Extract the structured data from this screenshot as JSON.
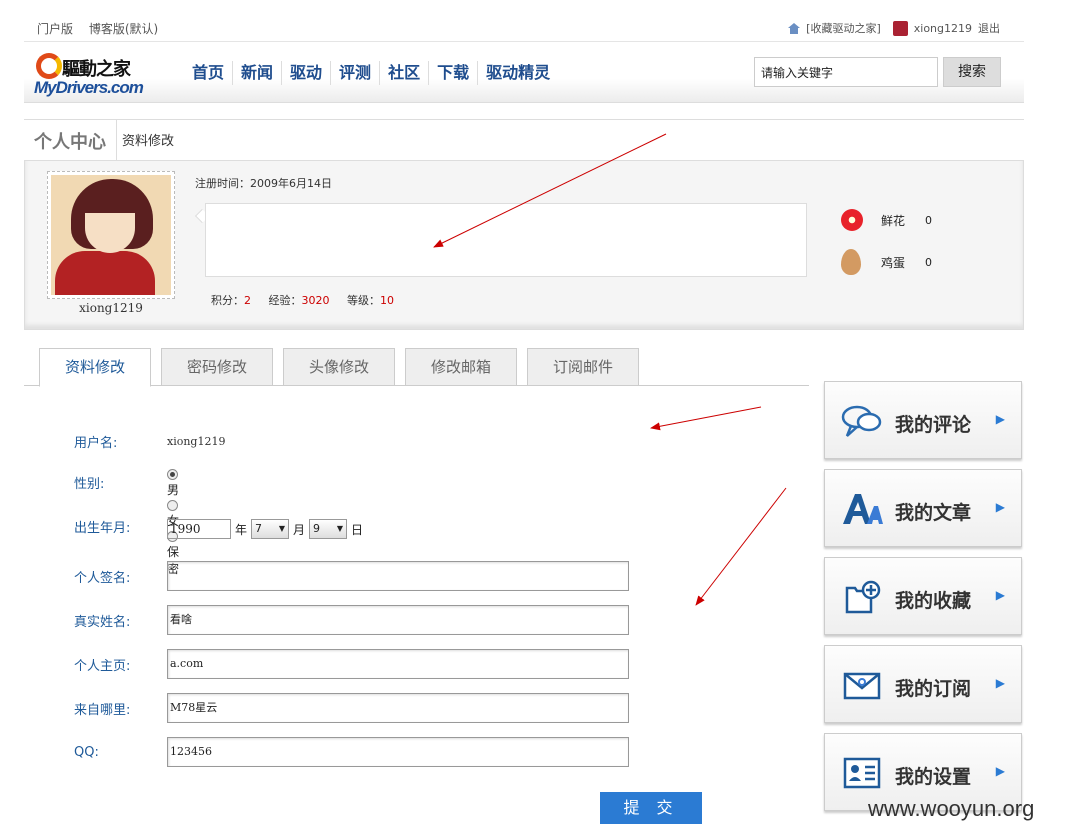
{
  "topbar": {
    "left_links": [
      "门户版",
      "博客版(默认)"
    ],
    "bookmark": "[收藏驱动之家]",
    "username": "xiong1219",
    "logout": "退出"
  },
  "header": {
    "logo_cn": "驅動之家",
    "logo_en": "MyDrivers.com",
    "nav": [
      "首页",
      "新闻",
      "驱动",
      "评测",
      "社区",
      "下载",
      "驱动精灵"
    ],
    "search_placeholder": "请输入关键字",
    "search_button": "搜索"
  },
  "breadcrumb": {
    "section": "个人中心",
    "page": "资料修改"
  },
  "profile": {
    "username": "xiong1219",
    "reg_time": "注册时间：2009年6月14日",
    "stats": [
      {
        "label": "积分：",
        "value": "2"
      },
      {
        "label": "经验：",
        "value": "3020"
      },
      {
        "label": "等级：",
        "value": "10"
      }
    ],
    "gifts": [
      {
        "name": "鲜花",
        "count": "0",
        "icon": "flower-icon"
      },
      {
        "name": "鸡蛋",
        "count": "0",
        "icon": "egg-icon"
      }
    ]
  },
  "tabs": [
    "资料修改",
    "密码修改",
    "头像修改",
    "修改邮箱",
    "订阅邮件"
  ],
  "form": {
    "username": {
      "label": "用户名:",
      "value": "xiong1219"
    },
    "gender": {
      "label": "性别:",
      "options": [
        "男",
        "女",
        "保密"
      ],
      "selected": "男"
    },
    "dob": {
      "label": "出生年月:",
      "year": "1990",
      "year_unit": "年",
      "month": "7",
      "month_unit": "月",
      "day": "9",
      "day_unit": "日"
    },
    "signature": {
      "label": "个人签名:",
      "value": ""
    },
    "realname": {
      "label": "真实姓名:",
      "value": "看啥"
    },
    "homepage": {
      "label": "个人主页:",
      "value": "a.com"
    },
    "from": {
      "label": "来自哪里:",
      "value": "M78星云"
    },
    "qq": {
      "label": "QQ:",
      "value": "123456"
    },
    "submit": "提 交"
  },
  "sidebar": [
    {
      "label": "我的评论",
      "icon": "comment-icon"
    },
    {
      "label": "我的文章",
      "icon": "article-icon"
    },
    {
      "label": "我的收藏",
      "icon": "favorite-icon"
    },
    {
      "label": "我的订阅",
      "icon": "subscribe-icon"
    },
    {
      "label": "我的设置",
      "icon": "settings-icon"
    }
  ],
  "watermark": "www.wooyun.org",
  "colors": {
    "accent": "#1f5a99",
    "button": "#2b7bd3",
    "annotation": "#cc0000"
  }
}
